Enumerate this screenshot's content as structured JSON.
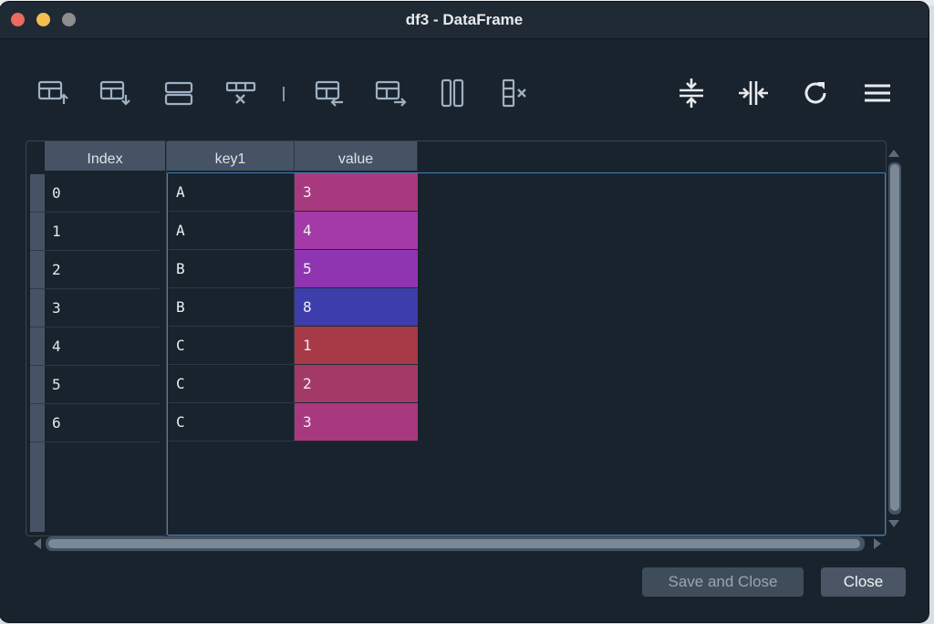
{
  "window": {
    "title": "df3 - DataFrame"
  },
  "toolbar": {
    "buttons": [
      {
        "icon": "insert-row-above-icon"
      },
      {
        "icon": "insert-row-below-icon"
      },
      {
        "icon": "duplicate-row-icon"
      },
      {
        "icon": "remove-row-icon"
      },
      {
        "icon": "insert-column-left-icon"
      },
      {
        "icon": "insert-column-right-icon"
      },
      {
        "icon": "duplicate-column-icon"
      },
      {
        "icon": "remove-column-icon"
      },
      {
        "icon": "resize-rows-icon"
      },
      {
        "icon": "resize-columns-icon"
      },
      {
        "icon": "refresh-icon"
      },
      {
        "icon": "menu-icon"
      }
    ]
  },
  "table": {
    "index_header": "Index",
    "columns": [
      "key1",
      "value"
    ],
    "index": [
      "0",
      "1",
      "2",
      "3",
      "4",
      "5",
      "6"
    ],
    "rows": [
      {
        "key1": "A",
        "value": "3",
        "color": "#a8397f"
      },
      {
        "key1": "A",
        "value": "4",
        "color": "#a33aa8"
      },
      {
        "key1": "B",
        "value": "5",
        "color": "#9035b2"
      },
      {
        "key1": "B",
        "value": "8",
        "color": "#3d3eab"
      },
      {
        "key1": "C",
        "value": "1",
        "color": "#a83946"
      },
      {
        "key1": "C",
        "value": "2",
        "color": "#a33a66"
      },
      {
        "key1": "C",
        "value": "3",
        "color": "#a8397f"
      }
    ]
  },
  "buttons": {
    "save_close": "Save and Close",
    "close": "Close"
  },
  "colors": {
    "window_bg": "#19232d",
    "header_bg": "#455364",
    "selection_border": "#3f7fbf"
  }
}
